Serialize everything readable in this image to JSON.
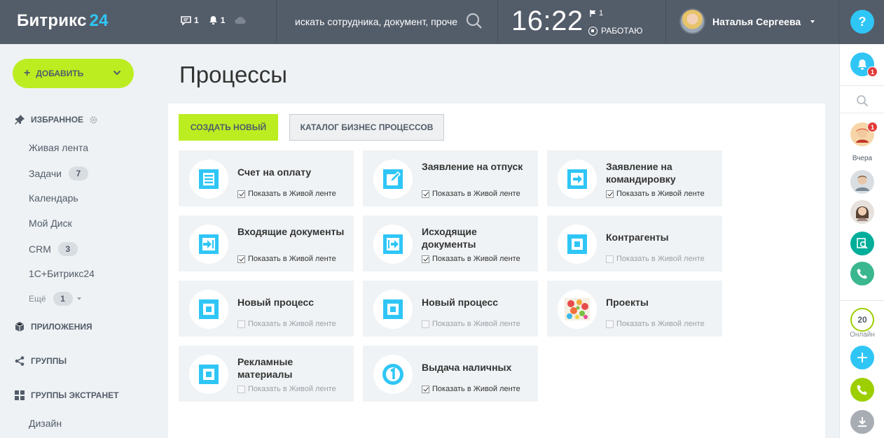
{
  "header": {
    "logo_main": "Битрикс",
    "logo_accent": "24",
    "messages_count": "1",
    "notifications_count": "1",
    "search_placeholder": "искать сотрудника, документ, прочее...",
    "clock": "16:22",
    "flag_count": "1",
    "work_status": "РАБОТАЮ",
    "user_name": "Наталья Сергеева",
    "help": "?"
  },
  "sidebar": {
    "add_button": "ДОБАВИТЬ",
    "favorites": "ИЗБРАННОЕ",
    "items": [
      {
        "label": "Живая лента",
        "count": ""
      },
      {
        "label": "Задачи",
        "count": "7"
      },
      {
        "label": "Календарь",
        "count": ""
      },
      {
        "label": "Мой Диск",
        "count": ""
      },
      {
        "label": "CRM",
        "count": "3"
      },
      {
        "label": "1С+Битрикс24",
        "count": ""
      }
    ],
    "more": {
      "label": "Ещё",
      "count": "1"
    },
    "apps": "ПРИЛОЖЕНИЯ",
    "groups": "ГРУППЫ",
    "extranet": "ГРУППЫ ЭКСТРАНЕТ",
    "extranet_item": "Дизайн"
  },
  "main": {
    "title": "Процессы",
    "create_button": "СОЗДАТЬ НОВЫЙ",
    "catalog_button": "КАТАЛОГ БИЗНЕС ПРОЦЕССОВ",
    "show_in_feed": "Показать в Живой ленте",
    "cards": [
      {
        "title": "Счет на оплату",
        "checked": true,
        "icon": "invoice-icon"
      },
      {
        "title": "Заявление на отпуск",
        "checked": true,
        "icon": "vacation-icon"
      },
      {
        "title": "Заявление на командировку",
        "checked": true,
        "icon": "trip-icon"
      },
      {
        "title": "Входящие документы",
        "checked": true,
        "icon": "incoming-docs-icon"
      },
      {
        "title": "Исходящие документы",
        "checked": true,
        "icon": "outgoing-docs-icon"
      },
      {
        "title": "Контрагенты",
        "checked": false,
        "icon": "process-icon"
      },
      {
        "title": "Новый процесс",
        "checked": false,
        "icon": "process-icon"
      },
      {
        "title": "Новый процесс",
        "checked": false,
        "icon": "process-icon"
      },
      {
        "title": "Проекты",
        "checked": false,
        "icon": "projects-image"
      },
      {
        "title": "Рекламные материалы",
        "checked": false,
        "icon": "process-icon"
      },
      {
        "title": "Выдача наличных",
        "checked": true,
        "icon": "cash-icon"
      }
    ]
  },
  "rightbar": {
    "notify_badge": "1",
    "chat_badge": "1",
    "yesterday": "Вчера",
    "online_count": "20",
    "online_label": "Онлайн"
  },
  "colors": {
    "header_bg": "#535c69",
    "accent_blue": "#2fc6f6",
    "accent_green": "#bbed21",
    "badge_red": "#e23a3a"
  }
}
